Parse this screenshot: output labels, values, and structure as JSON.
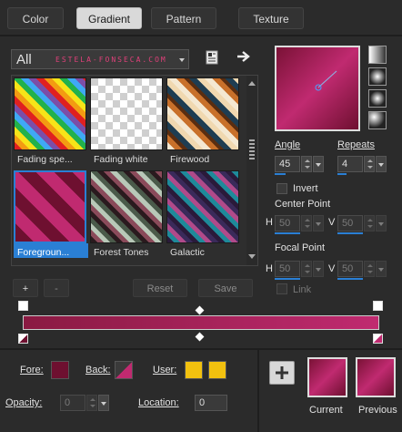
{
  "tabs": [
    {
      "label": "Color"
    },
    {
      "label": "Gradient"
    },
    {
      "label": "Pattern"
    },
    {
      "label": "Texture"
    }
  ],
  "library": {
    "category": "All",
    "watermark": "ESTELA-FONSECA.COM"
  },
  "presets": [
    {
      "label": "Fading spe..."
    },
    {
      "label": "Fading white"
    },
    {
      "label": "Firewood"
    },
    {
      "label": "Foregroun..."
    },
    {
      "label": "Forest Tones"
    },
    {
      "label": "Galactic"
    }
  ],
  "controls": {
    "add": "+",
    "remove": "-",
    "reset": "Reset",
    "save": "Save"
  },
  "angle": {
    "label": "Angle",
    "value": "45"
  },
  "repeats": {
    "label": "Repeats",
    "value": "4"
  },
  "invert": {
    "label": "Invert"
  },
  "center_point": {
    "label": "Center Point",
    "h_label": "H",
    "h_value": "50",
    "v_label": "V",
    "v_value": "50"
  },
  "focal_point": {
    "label": "Focal Point",
    "h_label": "H",
    "h_value": "50",
    "v_label": "V",
    "v_value": "50"
  },
  "link": {
    "label": "Link"
  },
  "fore": {
    "label": "Fore:",
    "color": "#6e1030"
  },
  "back": {
    "label": "Back:",
    "color": "#c02a70"
  },
  "user": {
    "label": "User:",
    "color1": "#f2c10f",
    "color2": "#f2c10f"
  },
  "opacity": {
    "label": "Opacity:",
    "value": "0"
  },
  "location": {
    "label": "Location:",
    "value": "0"
  },
  "current": {
    "label": "Current"
  },
  "previous": {
    "label": "Previous"
  },
  "colors": {
    "gradient_dark": "#6e1030",
    "gradient_light": "#c02a70",
    "accent_blue": "#2a7fd4"
  }
}
